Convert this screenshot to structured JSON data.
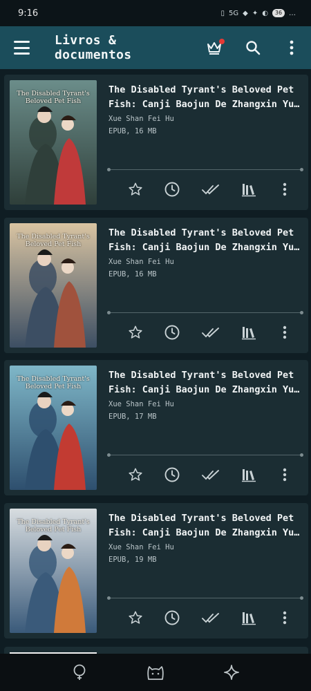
{
  "status_bar": {
    "time": "9:16",
    "signal": "5G",
    "battery": "36"
  },
  "app_bar": {
    "title": "Livros & documentos"
  },
  "books": [
    {
      "title": "The Disabled Tyrant's Beloved Pet Fish: Canji Baojun De Zhangxin Yu Chong Fei",
      "author": "Xue Shan Fei Hu",
      "meta": "EPUB, 16 MB",
      "cover_title": "The Disabled Tyrant's Beloved Pet Fish",
      "cover_colors": [
        "#6b8d8a",
        "#2f3f3a",
        "#c03a3a"
      ]
    },
    {
      "title": "The Disabled Tyrant's Beloved Pet Fish: Canji Baojun De Zhangxin Yu Chong Fei",
      "author": "Xue Shan Fei Hu",
      "meta": "EPUB, 16 MB",
      "cover_title": "The Disabled Tyrant's Beloved Pet Fish",
      "cover_colors": [
        "#d9c4a2",
        "#3c4e63",
        "#a0523d"
      ]
    },
    {
      "title": "The Disabled Tyrant's Beloved Pet Fish: Canji Baojun De Zhangxin Yu Chong Fei",
      "author": "Xue Shan Fei Hu",
      "meta": "EPUB, 17 MB",
      "cover_title": "The Disabled Tyrant's Beloved Pet Fish",
      "cover_colors": [
        "#7fb7c8",
        "#2e4f6e",
        "#c23b32"
      ]
    },
    {
      "title": "The Disabled Tyrant's Beloved Pet Fish: Canji Baojun De Zhangxin Yu Chong Fei",
      "author": "Xue Shan Fei Hu",
      "meta": "EPUB, 19 MB",
      "cover_title": "The Disabled Tyrant's Beloved Pet Fish",
      "cover_colors": [
        "#d8dde0",
        "#3a5a7a",
        "#d07a3a"
      ]
    }
  ],
  "colors": {
    "app_bar": "#1b4d5b",
    "card": "#1b2d33",
    "background": "#0f1d23",
    "notification_dot": "#e53935"
  },
  "icons": {
    "menu": "menu-icon",
    "premium": "crown-icon",
    "search": "search-icon",
    "more": "more-vert-icon",
    "favorite": "star-icon",
    "history": "clock-icon",
    "finished": "double-check-icon",
    "collections": "library-icon",
    "nav": [
      "lightbulb-icon",
      "cat-icon",
      "sparkle-icon"
    ]
  }
}
